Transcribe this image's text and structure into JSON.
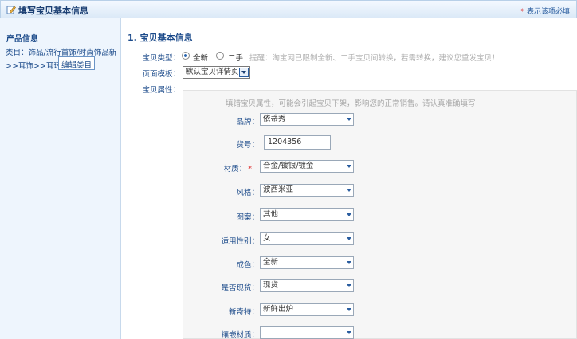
{
  "header": {
    "title": "填写宝贝基本信息",
    "required_star": "*",
    "required_note": "表示该项必填"
  },
  "sidebar": {
    "title": "产品信息",
    "category_line1": "类目：饰品/流行首饰/时尚饰品新",
    "category_line2": ">>耳饰>>耳环",
    "edit_category": "编辑类目"
  },
  "main": {
    "section_title": "1. 宝贝基本信息",
    "type_label": "宝贝类型：",
    "type_options": [
      "全新",
      "二手"
    ],
    "type_selected": "全新",
    "type_tip": "提醒：淘宝网已限制全新、二手宝贝间转换，若需转换，建议您重发宝贝！",
    "template_label": "页面模板：",
    "template_value": "默认宝贝详情页",
    "attr_label": "宝贝属性：",
    "attr_tip": "填错宝贝属性，可能会引起宝贝下架，影响您的正常销售。请认真准确填写"
  },
  "attributes": [
    {
      "label": "品牌：",
      "value": "依蒂秀",
      "kind": "select"
    },
    {
      "label": "货号：",
      "value": "1204356",
      "kind": "text"
    },
    {
      "label": "材质：",
      "value": "合金/镀银/镀金",
      "kind": "select",
      "required": true
    },
    {
      "label": "风格：",
      "value": "波西米亚",
      "kind": "select"
    },
    {
      "label": "图案：",
      "value": "其他",
      "kind": "select"
    },
    {
      "label": "适用性别：",
      "value": "女",
      "kind": "select"
    },
    {
      "label": "成色：",
      "value": "全新",
      "kind": "select"
    },
    {
      "label": "是否现货：",
      "value": "现货",
      "kind": "select"
    },
    {
      "label": "新奇特：",
      "value": "新鲜出炉",
      "kind": "select"
    },
    {
      "label": "镶嵌材质：",
      "value": "",
      "kind": "select"
    }
  ],
  "colors": {
    "accent": "#1b4a8a",
    "required": "#e03030",
    "sidebar_bg": "#eef5fd",
    "panel_bg": "#f6f6f6"
  }
}
